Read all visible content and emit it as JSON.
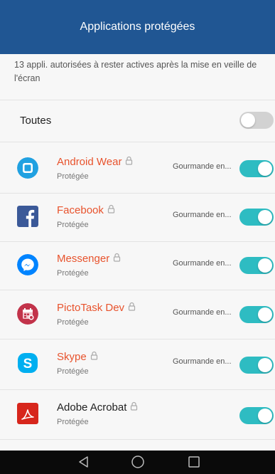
{
  "header": {
    "title": "Applications protégées"
  },
  "description": "13 appli. autorisées à rester actives après la mise en veille de l'écran",
  "all_toggle": {
    "label": "Toutes",
    "on": false
  },
  "colors": {
    "header_bg": "#205693",
    "toggle_on": "#2ebcc2",
    "app_name_accent": "#e8532d"
  },
  "apps": [
    {
      "name": "Android Wear",
      "subtitle": "Protégée",
      "status": "Gourmande en...",
      "icon": "android-wear-icon",
      "toggle_on": true
    },
    {
      "name": "Facebook",
      "subtitle": "Protégée",
      "status": "Gourmande en...",
      "icon": "facebook-icon",
      "toggle_on": true
    },
    {
      "name": "Messenger",
      "subtitle": "Protégée",
      "status": "Gourmande en...",
      "icon": "messenger-icon",
      "toggle_on": true
    },
    {
      "name": "PictoTask Dev",
      "subtitle": "Protégée",
      "status": "Gourmande en...",
      "icon": "pictotask-icon",
      "toggle_on": true
    },
    {
      "name": "Skype",
      "subtitle": "Protégée",
      "status": "Gourmande en...",
      "icon": "skype-icon",
      "toggle_on": true
    },
    {
      "name": "Adobe Acrobat",
      "subtitle": "Protégée",
      "status": "",
      "icon": "adobe-acrobat-icon",
      "toggle_on": true
    }
  ],
  "navbar": {
    "back": "back-icon",
    "home": "home-icon",
    "recents": "recents-icon"
  }
}
